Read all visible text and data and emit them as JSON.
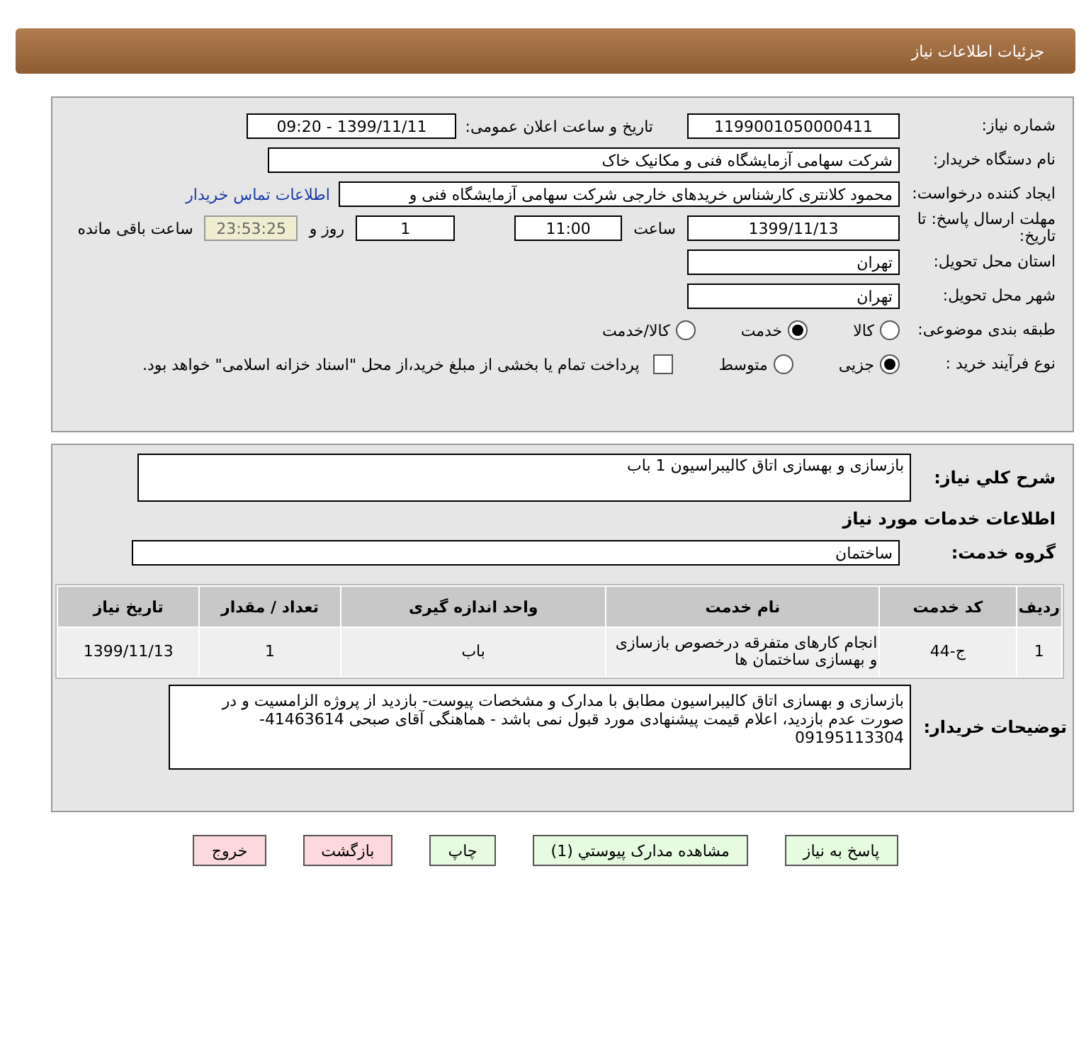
{
  "header": {
    "title": "جزئیات اطلاعات نیاز"
  },
  "details": {
    "need_number": {
      "label": "شماره نیاز:",
      "value": "1199001050000411"
    },
    "announce": {
      "label": "تاریخ و ساعت اعلان عمومی:",
      "value": "1399/11/11 - 09:20"
    },
    "buyer_org": {
      "label": "نام دستگاه خریدار:",
      "value": "شرکت سهامی آزمایشگاه فنی و مکانیک خاک"
    },
    "requester": {
      "label": "ایجاد کننده درخواست:",
      "value": "محمود کلانتری کارشناس خریدهای خارجی  شرکت سهامی آزمایشگاه فنی و",
      "link": "اطلاعات تماس خریدار"
    },
    "deadline": {
      "label": "مهلت ارسال پاسخ: تا تاریخ:",
      "date": "1399/11/13",
      "time_label": "ساعت",
      "time": "11:00",
      "days": "1",
      "days_label": "روز و",
      "remaining": "23:53:25",
      "remaining_label": "ساعت باقی مانده"
    },
    "province": {
      "label": "استان محل تحویل:",
      "value": "تهران"
    },
    "city": {
      "label": "شهر محل تحویل:",
      "value": "تهران"
    },
    "category": {
      "label": "طبقه بندی موضوعی:",
      "options": [
        {
          "label": "کالا",
          "selected": false
        },
        {
          "label": "خدمت",
          "selected": true
        },
        {
          "label": "کالا/خدمت",
          "selected": false
        }
      ]
    },
    "process": {
      "label": "نوع فرآیند خرید :",
      "options": [
        {
          "label": "جزیی",
          "selected": true
        },
        {
          "label": "متوسط",
          "selected": false
        }
      ],
      "payment": {
        "label": "پرداخت تمام یا بخشی از مبلغ خرید،از محل \"اسناد خزانه اسلامی\" خواهد بود.",
        "checked": false
      }
    }
  },
  "services": {
    "summary": {
      "label": "شرح کلي نياز:",
      "value": "بازسازی و بهسازی اتاق کالیبراسیون     1 باب"
    },
    "heading": "اطلاعات خدمات مورد نیاز",
    "group": {
      "label": "گروه خدمت:",
      "value": "ساختمان"
    },
    "table": {
      "columns": [
        "ردیف",
        "کد خدمت",
        "نام خدمت",
        "واحد اندازه گیری",
        "تعداد / مقدار",
        "تاریخ نیاز"
      ],
      "rows": [
        [
          "1",
          "ج-44",
          "انجام کارهای متفرقه درخصوص بازسازی و بهسازی ساختمان ها",
          "باب",
          "1",
          "1399/11/13"
        ]
      ]
    },
    "notes": {
      "label": "توضیحات خریدار:",
      "value": "بازسازی و بهسازی اتاق کالیبراسیون مطابق با مدارک و مشخصات پیوست- بازدید از پروژه الزامسیت و در صورت عدم بازدید، اعلام قیمت پیشنهادی مورد قبول نمی باشد - هماهنگی آقای صبحی 41463614-09195113304"
    }
  },
  "buttons": [
    {
      "label": "پاسخ به نیاز",
      "kind": "normal"
    },
    {
      "label": "مشاهده مدارک پیوستي (1)",
      "kind": "normal"
    },
    {
      "label": "چاپ",
      "kind": "normal"
    },
    {
      "label": "بازگشت",
      "kind": "exit"
    },
    {
      "label": "خروج",
      "kind": "exit"
    }
  ]
}
